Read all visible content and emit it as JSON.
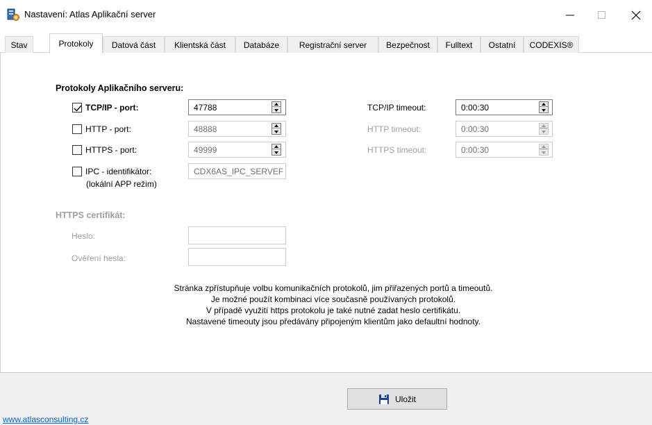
{
  "window": {
    "title": "Nastavení: Atlas Aplikační server",
    "controls": {
      "minimize": "—",
      "maximize": "☐",
      "close": "✕"
    }
  },
  "tabs": [
    {
      "label": "Stav"
    },
    {
      "label": "Protokoly",
      "active": true
    },
    {
      "label": "Datová část"
    },
    {
      "label": "Klientská část"
    },
    {
      "label": "Databáze"
    },
    {
      "label": "Registrační server"
    },
    {
      "label": "Bezpečnost"
    },
    {
      "label": "Fulltext"
    },
    {
      "label": "Ostatní"
    },
    {
      "label": "CODEXIS®"
    }
  ],
  "protocols": {
    "section_title": "Protokoly Aplikačního serveru:",
    "tcp": {
      "label": "TCP/IP - port:",
      "checked": true,
      "port": "47788",
      "timeout_label": "TCP/IP timeout:",
      "timeout": "0:00:30"
    },
    "http": {
      "label": "HTTP - port:",
      "checked": false,
      "port": "48888",
      "timeout_label": "HTTP timeout:",
      "timeout": "0:00:30"
    },
    "https": {
      "label": "HTTPS - port:",
      "checked": false,
      "port": "49999",
      "timeout_label": "HTTPS timeout:",
      "timeout": "0:00:30"
    },
    "ipc": {
      "label": "IPC - identifikátor:",
      "sublabel": "(lokální APP režim)",
      "checked": false,
      "value": "CDX6AS_IPC_SERVEF"
    }
  },
  "certificate": {
    "section_title": "HTTPS certifikát:",
    "password_label": "Heslo:",
    "password_value": "",
    "verify_label": "Ověření hesla:",
    "verify_value": ""
  },
  "info_lines": [
    "Stránka zpřístupňuje volbu komunikačních protokolů, jim přiřazených portů a timeoutů.",
    "Je možné použít kombinaci více současně používaných protokolů.",
    "V případě využití https protokolu je také nutné zadat heslo certifikátu.",
    "Nastavené timeouty jsou předávány připojeným klientům jako defaultní hodnoty."
  ],
  "footer": {
    "save_label": "Uložit",
    "link": "www.atlasconsulting.cz"
  },
  "colors": {
    "disabled_text": "#a0a0a0",
    "link": "#0066cc",
    "footer_bg": "#f0f0f0",
    "save_icon": "#1f3f8f"
  },
  "icons": {
    "app": "server-settings-icon",
    "save": "floppy-disk-icon",
    "check": "checkmark-icon"
  }
}
